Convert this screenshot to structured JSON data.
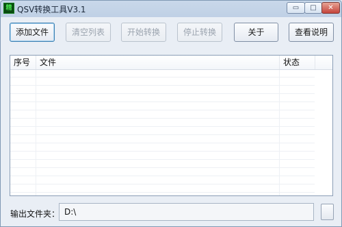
{
  "window": {
    "title": "QSV转换工具V3.1",
    "icon_glyph": "精",
    "minimize_icon": "▭",
    "maximize_icon": "□",
    "close_icon": "✕"
  },
  "toolbar": {
    "add_file": "添加文件",
    "clear_list": "清空列表",
    "start_convert": "开始转换",
    "stop_convert": "停止转换",
    "about": "关于",
    "view_help": "查看说明"
  },
  "file_list": {
    "columns": [
      "序号",
      "文件",
      "状态"
    ],
    "rows": []
  },
  "output": {
    "label": "输出文件夹：",
    "path": "D:\\"
  },
  "colors": {
    "accent": "#3c7fb1",
    "disabled_text": "#9aa3ae"
  }
}
